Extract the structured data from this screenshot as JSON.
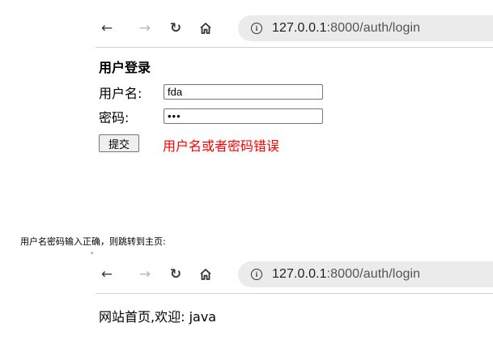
{
  "browser_top": {
    "back_icon": "arrow-left-icon",
    "forward_icon": "arrow-right-icon",
    "reload_icon": "reload-icon",
    "home_icon": "home-icon",
    "url_host": "127.0.0.1",
    "url_rest": ":8000/auth/login"
  },
  "login_form": {
    "title": "用户登录",
    "username_label": "用户名:",
    "username_value": "fda",
    "password_label": "密码:",
    "password_value": "•••",
    "submit_label": "提交",
    "error_message": "用户名或者密码错误",
    "error_color": "#ff0000"
  },
  "caption": "用户名密码输入正确，则跳转到主页:",
  "browser_bottom": {
    "url_host": "127.0.0.1",
    "url_rest": ":8000/auth/login"
  },
  "welcome_text": "网站首页,欢迎: java"
}
